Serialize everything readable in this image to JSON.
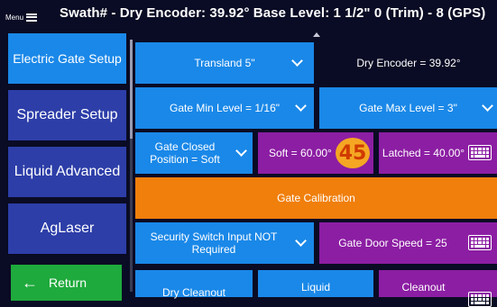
{
  "header": {
    "menu_label": "Menu",
    "title": "Swath# -   Dry Encoder: 39.92°   Base Level: 1 1/2\"  0 (Trim) - 8 (GPS)"
  },
  "sidebar": {
    "items": [
      {
        "label": "Electric Gate Setup",
        "active": true
      },
      {
        "label": "Spreader Setup",
        "active": false
      },
      {
        "label": "Liquid Advanced",
        "active": false
      },
      {
        "label": "AgLaser",
        "active": false
      }
    ],
    "return_label": "Return"
  },
  "main": {
    "gate_type": "Transland 5\"",
    "dry_encoder": "Dry Encoder = 39.92°",
    "gate_min_level": "Gate Min Level = 1/16\"",
    "gate_max_level": "Gate Max Level = 3\"",
    "gate_closed_position": "Gate Closed Position = Soft",
    "soft": "Soft = 60.00°",
    "soft_badge": "45",
    "latched": "Latched = 40.00°",
    "gate_calibration": "Gate Calibration",
    "security_switch": "Security Switch Input NOT Required",
    "gate_door_speed": "Gate Door Speed = 25",
    "dry_cleanout": "Dry Cleanout",
    "liquid": "Liquid",
    "cleanout": "Cleanout"
  },
  "colors": {
    "background": "#0a0b24",
    "nav_blue": "#2d3ea8",
    "active_blue": "#1a88e8",
    "purple": "#8c1ea3",
    "orange": "#f07f0c",
    "green": "#1eaa3c",
    "badge": "#f5a623"
  }
}
